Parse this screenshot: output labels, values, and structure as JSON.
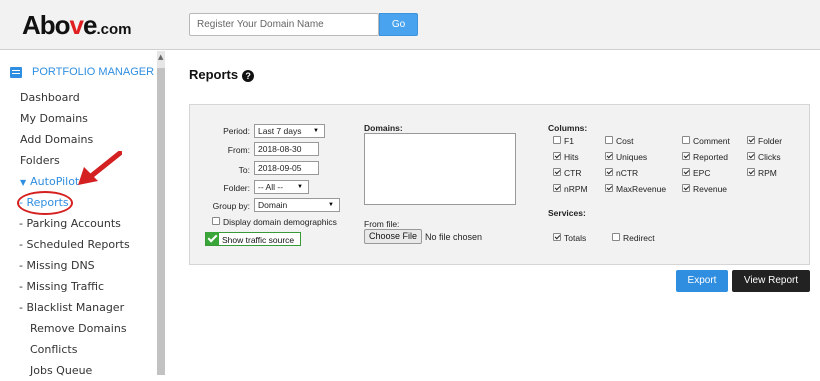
{
  "header": {
    "logo_main": "Abo",
    "logo_v": "v",
    "logo_e": "e",
    "logo_suffix": ".com",
    "domain_search": {
      "placeholder": "Register Your Domain Name",
      "value": ""
    },
    "go_label": "Go"
  },
  "sidebar": {
    "section_title": "PORTFOLIO MANAGER",
    "items": [
      {
        "label": "Dashboard"
      },
      {
        "label": "My Domains"
      },
      {
        "label": "Add Domains"
      },
      {
        "label": "Folders"
      },
      {
        "label": "AutoPilot",
        "caret": "▼"
      },
      {
        "label": "- Reports"
      },
      {
        "label": "- Parking Accounts"
      },
      {
        "label": "- Scheduled Reports"
      },
      {
        "label": "- Missing DNS"
      },
      {
        "label": "- Missing Traffic"
      },
      {
        "label": "- Blacklist Manager"
      },
      {
        "label": "Remove Domains"
      },
      {
        "label": "Conflicts"
      },
      {
        "label": "Jobs Queue"
      }
    ]
  },
  "main": {
    "title": "Reports",
    "help_glyph": "?",
    "filters": {
      "period_label": "Period:",
      "period_value": "Last 7 days",
      "from_label": "From:",
      "from_value": "2018-08-30",
      "to_label": "To:",
      "to_value": "2018-09-05",
      "folder_label": "Folder:",
      "folder_value": "-- All --",
      "group_label": "Group by:",
      "group_value": "Domain",
      "demographics_label": "Display domain demographics",
      "traffic_label": "Show traffic source"
    },
    "domains_label": "Domains:",
    "from_file_label": "From file:",
    "choose_file_label": "Choose File",
    "no_file_label": "No file chosen",
    "columns_label": "Columns:",
    "columns": [
      {
        "label": "F1",
        "checked": false
      },
      {
        "label": "Cost",
        "checked": false
      },
      {
        "label": "Comment",
        "checked": false
      },
      {
        "label": "Folder",
        "checked": true
      },
      {
        "label": "Hits",
        "checked": true
      },
      {
        "label": "Uniques",
        "checked": true
      },
      {
        "label": "Reported",
        "checked": true
      },
      {
        "label": "Clicks",
        "checked": true
      },
      {
        "label": "CTR",
        "checked": true
      },
      {
        "label": "nCTR",
        "checked": true
      },
      {
        "label": "EPC",
        "checked": true
      },
      {
        "label": "RPM",
        "checked": true
      },
      {
        "label": "nRPM",
        "checked": true
      },
      {
        "label": "MaxRevenue",
        "checked": true
      },
      {
        "label": "Revenue",
        "checked": true
      }
    ],
    "services_label": "Services:",
    "services": [
      {
        "label": "Totals",
        "checked": true
      },
      {
        "label": "Redirect",
        "checked": false
      }
    ],
    "export_label": "Export",
    "view_report_label": "View Report"
  }
}
